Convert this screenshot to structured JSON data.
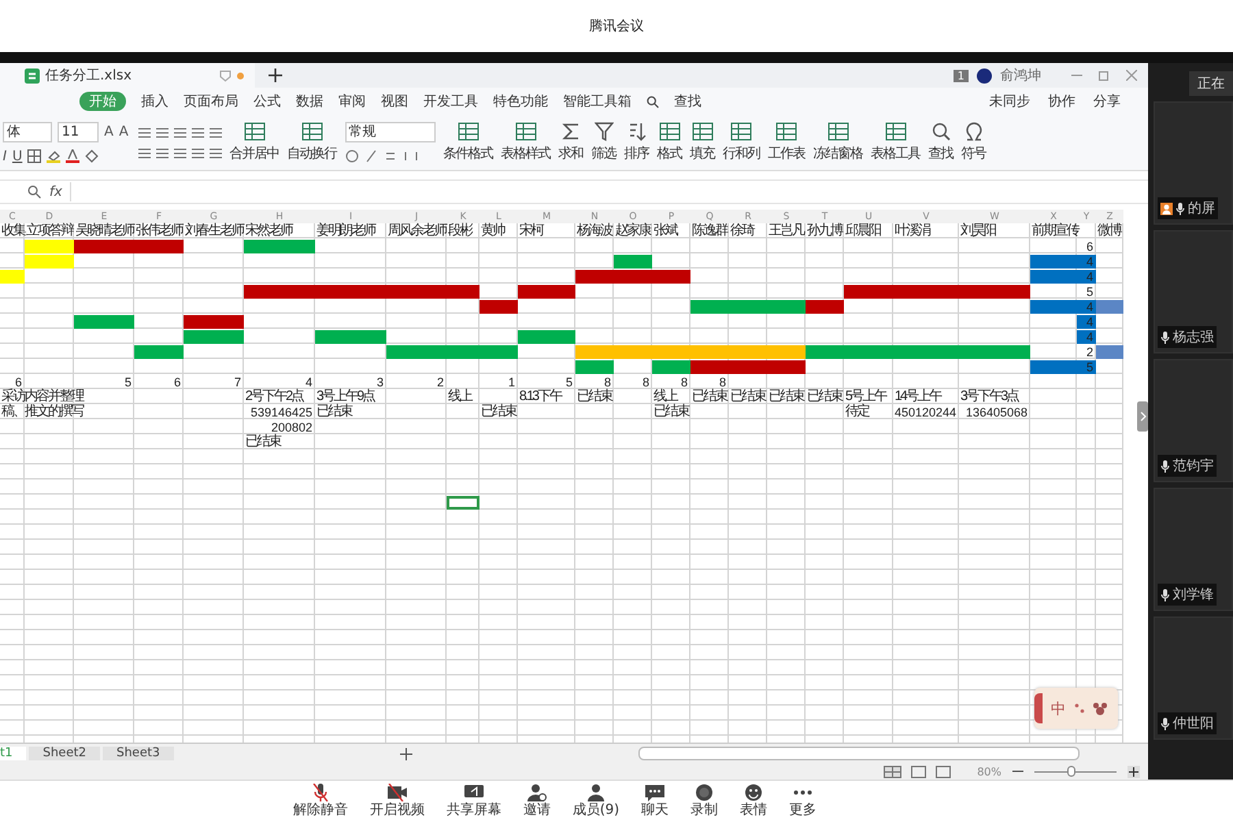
{
  "meeting": {
    "title": "腾讯会议"
  },
  "excel": {
    "file_tab": "任务分工.xlsx",
    "badge": "1",
    "user": "俞鸿坤",
    "menu": [
      {
        "label": "开始",
        "selected": true
      },
      {
        "label": "插入",
        "selected": false
      },
      {
        "label": "页面布局",
        "selected": false
      },
      {
        "label": "公式",
        "selected": false
      },
      {
        "label": "数据",
        "selected": false
      },
      {
        "label": "审阅",
        "selected": false
      },
      {
        "label": "视图",
        "selected": false
      },
      {
        "label": "开发工具",
        "selected": false
      },
      {
        "label": "特色功能",
        "selected": false
      },
      {
        "label": "智能工具箱",
        "selected": false
      },
      {
        "label": "查找",
        "selected": false
      }
    ],
    "menu_right": [
      "未同步",
      "协作",
      "分享"
    ],
    "font": "体",
    "font_size": "11",
    "style_glyphs": [
      "I",
      "U"
    ],
    "size_glyphs": [
      "A",
      "A"
    ],
    "number_format": "常规",
    "toolbar_buttons": [
      "合并居中",
      "自动换行",
      "条件格式",
      "表格样式",
      "求和",
      "筛选",
      "排序",
      "格式",
      "填充",
      "行和列",
      "工作表",
      "冻结窗格",
      "表格工具",
      "查找",
      "符号"
    ],
    "formula_label": "fx",
    "columns": [
      "C",
      "D",
      "E",
      "F",
      "G",
      "H",
      "I",
      "J",
      "K",
      "L",
      "M",
      "N",
      "O",
      "P",
      "Q",
      "R",
      "S",
      "T",
      "U",
      "V",
      "W",
      "X",
      "Y",
      "Z"
    ],
    "rows": [
      {
        "cells": [
          {
            "text": "收集"
          },
          {
            "text": "立项答辩"
          },
          {
            "text": "吴晓晴老师"
          },
          {
            "text": "张伟老师"
          },
          {
            "text": "刘春生老师"
          },
          {
            "text": "宋然老师"
          },
          {
            "text": "姜明朗老师"
          },
          {
            "text": "周风余老师"
          },
          {
            "text": "段彬"
          },
          {
            "text": "黄帅"
          },
          {
            "text": "宋柯"
          },
          {
            "text": "杨海波"
          },
          {
            "text": "赵家康"
          },
          {
            "text": "张斌"
          },
          {
            "text": "陈逸群"
          },
          {
            "text": "徐琦"
          },
          {
            "text": "王岂凡"
          },
          {
            "text": "孙九博"
          },
          {
            "text": "邱晨阳"
          },
          {
            "text": "叶溪涓"
          },
          {
            "text": "刘昊阳"
          },
          {
            "text": "前期宣传"
          },
          {},
          {
            "text": "微博"
          }
        ]
      },
      {
        "cells": [
          {},
          {
            "color": "#ffff00"
          },
          {
            "color": "#c00000"
          },
          {
            "color": "#c00000"
          },
          {},
          {
            "color": "#00b050"
          },
          {},
          {},
          {},
          {},
          {},
          {},
          {},
          {},
          {},
          {},
          {},
          {},
          {},
          {},
          {},
          {},
          {
            "text": "6",
            "kind": "number"
          },
          {}
        ]
      },
      {
        "cells": [
          {},
          {
            "color": "#ffff00"
          },
          {},
          {},
          {},
          {},
          {},
          {},
          {},
          {},
          {},
          {},
          {
            "color": "#00b050"
          },
          {},
          {},
          {},
          {},
          {},
          {},
          {},
          {},
          {
            "color": "#0070c0"
          },
          {
            "text": "4",
            "kind": "number",
            "color": "#0070c0"
          },
          {}
        ]
      },
      {
        "cells": [
          {
            "color": "#ffff00"
          },
          {},
          {},
          {},
          {},
          {},
          {},
          {},
          {},
          {},
          {},
          {
            "color": "#c00000"
          },
          {
            "color": "#c00000"
          },
          {
            "color": "#c00000"
          },
          {},
          {},
          {},
          {},
          {},
          {},
          {},
          {
            "color": "#0070c0"
          },
          {
            "text": "4",
            "kind": "number",
            "color": "#0070c0"
          },
          {}
        ]
      },
      {
        "cells": [
          {},
          {},
          {},
          {},
          {},
          {
            "color": "#c00000"
          },
          {
            "color": "#c00000"
          },
          {
            "color": "#c00000"
          },
          {
            "color": "#c00000"
          },
          {},
          {
            "color": "#c00000"
          },
          {},
          {},
          {},
          {},
          {},
          {},
          {},
          {
            "color": "#c00000"
          },
          {
            "color": "#c00000"
          },
          {
            "color": "#c00000"
          },
          {},
          {
            "text": "5",
            "kind": "number"
          },
          {}
        ]
      },
      {
        "cells": [
          {},
          {},
          {},
          {},
          {},
          {},
          {},
          {},
          {},
          {
            "color": "#c00000"
          },
          {},
          {},
          {},
          {},
          {
            "color": "#00b050"
          },
          {
            "color": "#00b050"
          },
          {
            "color": "#00b050"
          },
          {
            "color": "#c00000"
          },
          {},
          {},
          {},
          {
            "color": "#0070c0"
          },
          {
            "text": "4",
            "kind": "number",
            "color": "#0070c0"
          },
          {
            "color": "#5b86c5"
          }
        ]
      },
      {
        "cells": [
          {},
          {},
          {
            "color": "#00b050"
          },
          {},
          {
            "color": "#c00000"
          },
          {},
          {},
          {},
          {},
          {},
          {},
          {},
          {},
          {},
          {},
          {},
          {},
          {},
          {},
          {},
          {},
          {},
          {
            "text": "4",
            "kind": "number",
            "color": "#0070c0"
          },
          {}
        ]
      },
      {
        "cells": [
          {},
          {},
          {},
          {},
          {
            "color": "#00b050"
          },
          {},
          {
            "color": "#00b050"
          },
          {},
          {},
          {},
          {
            "color": "#00b050"
          },
          {},
          {},
          {},
          {},
          {},
          {},
          {},
          {},
          {},
          {},
          {},
          {
            "text": "4",
            "kind": "number",
            "color": "#0070c0"
          },
          {}
        ]
      },
      {
        "cells": [
          {},
          {},
          {},
          {
            "color": "#00b050"
          },
          {},
          {},
          {},
          {
            "color": "#00b050"
          },
          {
            "color": "#00b050"
          },
          {
            "color": "#00b050"
          },
          {},
          {
            "color": "#ffc000"
          },
          {
            "color": "#ffc000"
          },
          {
            "color": "#ffc000"
          },
          {
            "color": "#ffc000"
          },
          {
            "color": "#ffc000"
          },
          {
            "color": "#ffc000"
          },
          {
            "color": "#00b050"
          },
          {
            "color": "#00b050"
          },
          {
            "color": "#00b050"
          },
          {
            "color": "#00b050"
          },
          {},
          {
            "text": "2",
            "kind": "number"
          },
          {
            "color": "#5b86c5"
          }
        ]
      },
      {
        "cells": [
          {},
          {},
          {},
          {},
          {},
          {},
          {},
          {},
          {},
          {},
          {},
          {
            "color": "#00b050"
          },
          {},
          {
            "color": "#00b050"
          },
          {
            "color": "#c00000"
          },
          {
            "color": "#c00000"
          },
          {
            "color": "#c00000"
          },
          {},
          {},
          {},
          {},
          {
            "color": "#0070c0"
          },
          {
            "text": "5",
            "kind": "number",
            "color": "#0070c0"
          },
          {}
        ]
      },
      {
        "cells": [
          {
            "text": "6",
            "kind": "number"
          },
          {},
          {
            "text": "5",
            "kind": "number"
          },
          {
            "text": "6",
            "kind": "number"
          },
          {
            "text": "7",
            "kind": "number"
          },
          {
            "text": "4",
            "kind": "number"
          },
          {
            "text": "3",
            "kind": "number"
          },
          {
            "text": "2",
            "kind": "number"
          },
          {},
          {
            "text": "1",
            "kind": "number"
          },
          {
            "text": "5",
            "kind": "number"
          },
          {
            "text": "8",
            "kind": "number"
          },
          {
            "text": "8",
            "kind": "number"
          },
          {
            "text": "8",
            "kind": "number"
          },
          {
            "text": "8",
            "kind": "number"
          },
          {},
          {},
          {},
          {},
          {},
          {},
          {},
          {},
          {}
        ]
      },
      {
        "cells": [
          {
            "text": "采访内容并整理"
          },
          {},
          {},
          {},
          {},
          {
            "text": "2号下午2点"
          },
          {
            "text": "3号上午9点"
          },
          {},
          {
            "text": "线上"
          },
          {},
          {
            "text": "8.13下午"
          },
          {
            "text": "已结束"
          },
          {},
          {
            "text": "线上"
          },
          {
            "text": "已结束"
          },
          {
            "text": "已结束"
          },
          {
            "text": "已结束"
          },
          {
            "text": "已结束"
          },
          {
            "text": "5号上午"
          },
          {
            "text": "14号上午"
          },
          {
            "text": "3号下午3点"
          },
          {},
          {},
          {}
        ]
      },
      {
        "cells": [
          {
            "text": "稿、推文的撰写"
          },
          {},
          {},
          {},
          {},
          {
            "text": "539146425",
            "kind": "number"
          },
          {
            "text": "已结束"
          },
          {},
          {},
          {
            "text": "已结束"
          },
          {},
          {},
          {},
          {
            "text": "已结束"
          },
          {},
          {},
          {},
          {},
          {
            "text": "待定"
          },
          {
            "text": "450120244",
            "kind": "number"
          },
          {
            "text": "136405068",
            "kind": "number"
          },
          {},
          {},
          {}
        ]
      },
      {
        "cells": [
          {},
          {},
          {},
          {},
          {},
          {
            "text": "200802",
            "kind": "number"
          },
          {},
          {},
          {},
          {},
          {},
          {},
          {},
          {},
          {},
          {},
          {},
          {},
          {},
          {},
          {},
          {},
          {},
          {}
        ]
      },
      {
        "cells": [
          {},
          {},
          {},
          {},
          {},
          {
            "text": "已结束"
          },
          {},
          {},
          {},
          {},
          {},
          {},
          {},
          {},
          {},
          {},
          {},
          {},
          {},
          {},
          {},
          {},
          {},
          {}
        ]
      },
      {
        "cells": [
          {},
          {},
          {},
          {},
          {},
          {},
          {},
          {},
          {},
          {},
          {},
          {},
          {},
          {},
          {},
          {},
          {},
          {},
          {},
          {},
          {},
          {},
          {},
          {}
        ]
      },
      {
        "cells": [
          {},
          {},
          {},
          {},
          {},
          {},
          {},
          {},
          {},
          {},
          {},
          {},
          {},
          {},
          {},
          {},
          {},
          {},
          {},
          {},
          {},
          {},
          {},
          {}
        ]
      },
      {
        "cells": [
          {},
          {},
          {},
          {},
          {},
          {},
          {},
          {},
          {},
          {},
          {},
          {},
          {},
          {},
          {},
          {},
          {},
          {},
          {},
          {},
          {},
          {},
          {},
          {}
        ]
      },
      {
        "cells": [
          {},
          {},
          {},
          {},
          {},
          {},
          {},
          {},
          {
            "selected": true
          },
          {},
          {},
          {},
          {},
          {},
          {},
          {},
          {},
          {},
          {},
          {},
          {},
          {},
          {},
          {}
        ]
      }
    ],
    "sheet_tabs": [
      {
        "label": "t1",
        "selected": true
      },
      {
        "label": "Sheet2",
        "selected": false
      },
      {
        "label": "Sheet3",
        "selected": false
      }
    ],
    "zoom": "80%",
    "zoom_slider": {
      "level": 0.45
    }
  },
  "meeting_toolbar": [
    "解除静音",
    "开启视频",
    "共享屏幕",
    "邀请",
    "成员(9)",
    "聊天",
    "录制",
    "表情",
    "更多"
  ],
  "participants": {
    "status_button": "正在",
    "tiles": [
      "的屏",
      "杨志强",
      "范钧宇",
      "刘学锋",
      "仲世阳"
    ]
  },
  "ime": {
    "label": "中"
  }
}
